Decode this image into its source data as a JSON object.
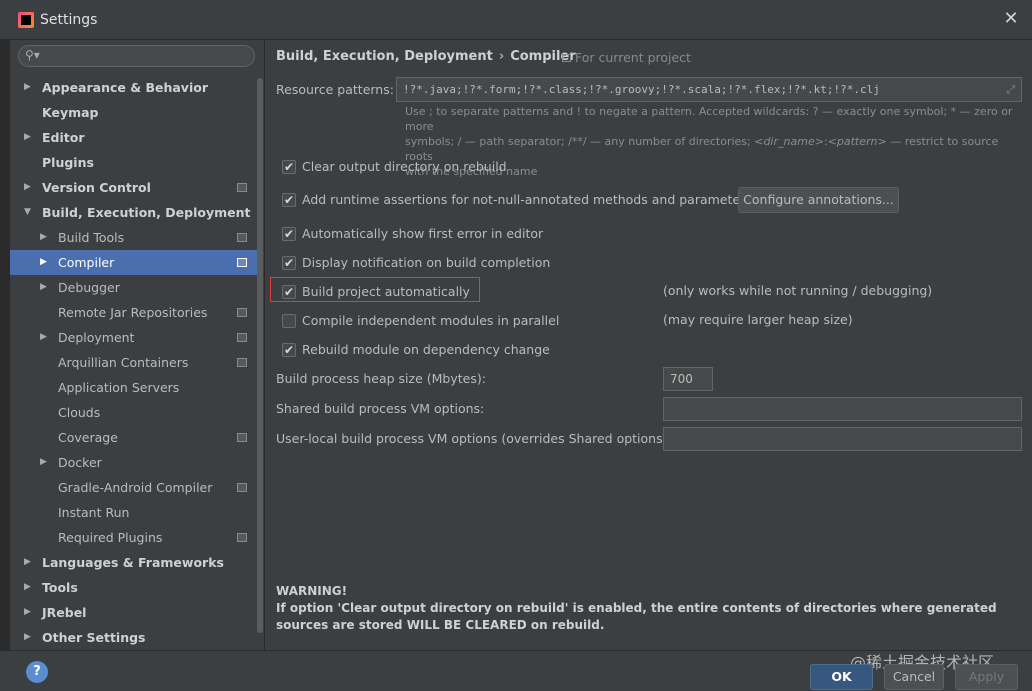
{
  "window": {
    "title": "Settings",
    "close_icon": "close-icon"
  },
  "search": {
    "placeholder": "",
    "icon": "search-icon"
  },
  "sidebar": {
    "items": [
      {
        "label": "Appearance & Behavior",
        "level": 0,
        "bold": true,
        "arrow": "right",
        "project": false,
        "selected": false
      },
      {
        "label": "Keymap",
        "level": 0,
        "bold": true,
        "arrow": "",
        "project": false,
        "selected": false
      },
      {
        "label": "Editor",
        "level": 0,
        "bold": true,
        "arrow": "right",
        "project": false,
        "selected": false
      },
      {
        "label": "Plugins",
        "level": 0,
        "bold": true,
        "arrow": "",
        "project": false,
        "selected": false
      },
      {
        "label": "Version Control",
        "level": 0,
        "bold": true,
        "arrow": "right",
        "project": true,
        "selected": false
      },
      {
        "label": "Build, Execution, Deployment",
        "level": 0,
        "bold": true,
        "arrow": "down",
        "project": false,
        "selected": false
      },
      {
        "label": "Build Tools",
        "level": 1,
        "bold": false,
        "arrow": "right",
        "project": true,
        "selected": false
      },
      {
        "label": "Compiler",
        "level": 1,
        "bold": false,
        "arrow": "right",
        "project": true,
        "selected": true
      },
      {
        "label": "Debugger",
        "level": 1,
        "bold": false,
        "arrow": "right",
        "project": false,
        "selected": false
      },
      {
        "label": "Remote Jar Repositories",
        "level": 1,
        "bold": false,
        "arrow": "",
        "project": true,
        "selected": false
      },
      {
        "label": "Deployment",
        "level": 1,
        "bold": false,
        "arrow": "right",
        "project": true,
        "selected": false
      },
      {
        "label": "Arquillian Containers",
        "level": 1,
        "bold": false,
        "arrow": "",
        "project": true,
        "selected": false
      },
      {
        "label": "Application Servers",
        "level": 1,
        "bold": false,
        "arrow": "",
        "project": false,
        "selected": false
      },
      {
        "label": "Clouds",
        "level": 1,
        "bold": false,
        "arrow": "",
        "project": false,
        "selected": false
      },
      {
        "label": "Coverage",
        "level": 1,
        "bold": false,
        "arrow": "",
        "project": true,
        "selected": false
      },
      {
        "label": "Docker",
        "level": 1,
        "bold": false,
        "arrow": "right",
        "project": false,
        "selected": false
      },
      {
        "label": "Gradle-Android Compiler",
        "level": 1,
        "bold": false,
        "arrow": "",
        "project": true,
        "selected": false
      },
      {
        "label": "Instant Run",
        "level": 1,
        "bold": false,
        "arrow": "",
        "project": false,
        "selected": false
      },
      {
        "label": "Required Plugins",
        "level": 1,
        "bold": false,
        "arrow": "",
        "project": true,
        "selected": false
      },
      {
        "label": "Languages & Frameworks",
        "level": 0,
        "bold": true,
        "arrow": "right",
        "project": false,
        "selected": false
      },
      {
        "label": "Tools",
        "level": 0,
        "bold": true,
        "arrow": "right",
        "project": false,
        "selected": false
      },
      {
        "label": "JRebel",
        "level": 0,
        "bold": true,
        "arrow": "right",
        "project": false,
        "selected": false
      },
      {
        "label": "Other Settings",
        "level": 0,
        "bold": true,
        "arrow": "right",
        "project": false,
        "selected": false
      }
    ]
  },
  "content": {
    "breadcrumb": [
      "Build, Execution, Deployment",
      "Compiler"
    ],
    "for_project": "For current project",
    "resource_patterns": {
      "label": "Resource patterns:",
      "value": "!?*.java;!?*.form;!?*.class;!?*.groovy;!?*.scala;!?*.flex;!?*.kt;!?*.clj",
      "hint_1": "Use ; to separate patterns and ! to negate a pattern. Accepted wildcards: ? — exactly one symbol; * — zero or more",
      "hint_2a": "symbols; / — path separator; /**/ — any number of directories; ",
      "hint_2b": "<dir_name>",
      "hint_2c": ":",
      "hint_2d": "<pattern>",
      "hint_2e": " — restrict to source roots",
      "hint_3": "with the specified name"
    },
    "options": [
      {
        "label": "Clear output directory on rebuild",
        "checked": true
      },
      {
        "label": "Add runtime assertions for not-null-annotated methods and parameters",
        "checked": true
      },
      {
        "label": "Automatically show first error in editor",
        "checked": true
      },
      {
        "label": "Display notification on build completion",
        "checked": true
      },
      {
        "label": "Build project automatically",
        "checked": true,
        "note": "(only works while not running / debugging)"
      },
      {
        "label": "Compile independent modules in parallel",
        "checked": false,
        "note": "(may require larger heap size)"
      },
      {
        "label": "Rebuild module on dependency change",
        "checked": true
      }
    ],
    "configure_button": "Configure annotations...",
    "heap": {
      "label": "Build process heap size (Mbytes):",
      "value": "700"
    },
    "shared_vm": {
      "label": "Shared build process VM options:",
      "value": ""
    },
    "user_vm": {
      "label": "User-local build process VM options (overrides Shared options):",
      "value": ""
    },
    "warning_title": "WARNING!",
    "warning_text": "If option 'Clear output directory on rebuild' is enabled, the entire contents of directories where generated sources are stored WILL BE CLEARED on rebuild."
  },
  "footer": {
    "help_label": "?",
    "watermark": "@稀土掘金技术社区",
    "ok": "OK",
    "cancel": "Cancel",
    "apply": "Apply"
  },
  "colors": {
    "selection": "#4b6eaf",
    "highlight_box": "#e03c3c",
    "ok_button": "#365880"
  }
}
